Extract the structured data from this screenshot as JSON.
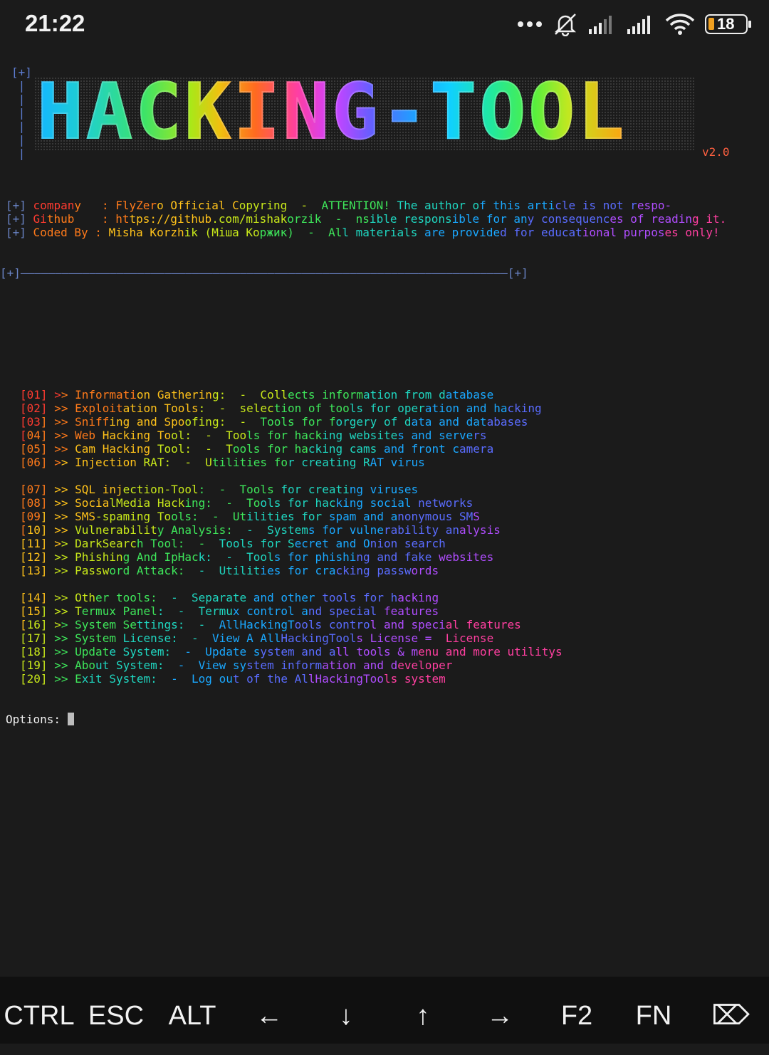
{
  "status_bar": {
    "time": "21:22",
    "battery": "18",
    "icons": [
      "more-dots-icon",
      "bell-off-icon",
      "signal-1-icon",
      "signal-2-icon",
      "wifi-icon",
      "battery-icon"
    ]
  },
  "banner": {
    "top_marker": "[+]",
    "logo_text": "HACKING-TOOL",
    "version": "v2.0",
    "info_lines": [
      {
        "prefix": "[+]",
        "key": "company  ",
        "value": " : FlyZero Official Copyring",
        "sep": "  -  ",
        "note": "ATTENTION! The author of this article is not respo-"
      },
      {
        "prefix": "[+]",
        "key": "Github   ",
        "value": " : https://github.com/mishakorzik",
        "sep": "  -  ",
        "note": "nsible responsible for any consequences of reading it."
      },
      {
        "prefix": "[+]",
        "key": "Coded By",
        "value": " : Misha Korzhik (Міша Коржик)",
        "sep": "  -  ",
        "note": "All materials are provided for educational purposes only!"
      }
    ],
    "divider": "[+]———————————————————————————————————————————————————————————————————————[+]"
  },
  "menu": {
    "groups": [
      [
        {
          "num": "[01]",
          "name": "Information Gathering:",
          "desc": "Collects information from database"
        },
        {
          "num": "[02]",
          "name": "Exploitation Tools:",
          "desc": "selection of tools for operation and hacking"
        },
        {
          "num": "[03]",
          "name": "Sniffing and Spoofing:",
          "desc": "Tools for forgery of data and databases"
        },
        {
          "num": "[04]",
          "name": "Web Hacking Tool:",
          "desc": "Tools for hacking websites and servers"
        },
        {
          "num": "[05]",
          "name": "Cam Hacking Tool:",
          "desc": "Tools for hacking cams and front camera"
        },
        {
          "num": "[06]",
          "name": "Injection RAT:",
          "desc": "Utilities for creating RAT virus"
        }
      ],
      [
        {
          "num": "[07]",
          "name": "SQL injection-Tool:",
          "desc": "Tools for creating viruses"
        },
        {
          "num": "[08]",
          "name": "SocialMedia Hacking:",
          "desc": "Tools for hacking social networks"
        },
        {
          "num": "[09]",
          "name": "SMS-spaming Tools:",
          "desc": "Utilities for spam and anonymous SMS"
        },
        {
          "num": "[10]",
          "name": "Vulnerability Analysis:",
          "desc": "Systems for vulnerability analysis"
        },
        {
          "num": "[11]",
          "name": "DarkSearch Tool:",
          "desc": "Tools for Secret and Onion search"
        },
        {
          "num": "[12]",
          "name": "Phishing And IpHack:",
          "desc": "Tools for phishing and fake websites"
        },
        {
          "num": "[13]",
          "name": "Password Attack:",
          "desc": "Utilities for cracking passwords"
        }
      ],
      [
        {
          "num": "[14]",
          "name": "Other tools:",
          "desc": "Separate and other tools for hacking"
        },
        {
          "num": "[15]",
          "name": "Termux Panel:",
          "desc": "Termux control and special features"
        },
        {
          "num": "[16]",
          "name": "System Settings:",
          "desc": "AllHackingTools control and special features"
        },
        {
          "num": "[17]",
          "name": "System License:",
          "desc": "View A AllHackingTools License =  License"
        },
        {
          "num": "[18]",
          "name": "Update System:",
          "desc": "Update system and all tools & menu and more utilitys"
        },
        {
          "num": "[19]",
          "name": "About System:",
          "desc": "View system information and developer"
        },
        {
          "num": "[20]",
          "name": "Exit System:",
          "desc": "Log out of the AllHackingTools system"
        }
      ]
    ],
    "arrow": ">>",
    "dash": "-"
  },
  "prompt": {
    "label": "Options: "
  },
  "extra_keys": [
    "CTRL",
    "ESC",
    "ALT",
    "←",
    "↓",
    "↑",
    "→",
    "F2",
    "FN",
    "⌦"
  ],
  "colors": {
    "background": "#1b1b1b",
    "keys_bar": "#101010",
    "rainbow": [
      "#ff3b30",
      "#ff7a1a",
      "#ffc21a",
      "#c8e81a",
      "#3ee65a",
      "#1fd6c0",
      "#1aa8ff",
      "#5a6cff",
      "#b04dff",
      "#ff3fa0"
    ]
  }
}
